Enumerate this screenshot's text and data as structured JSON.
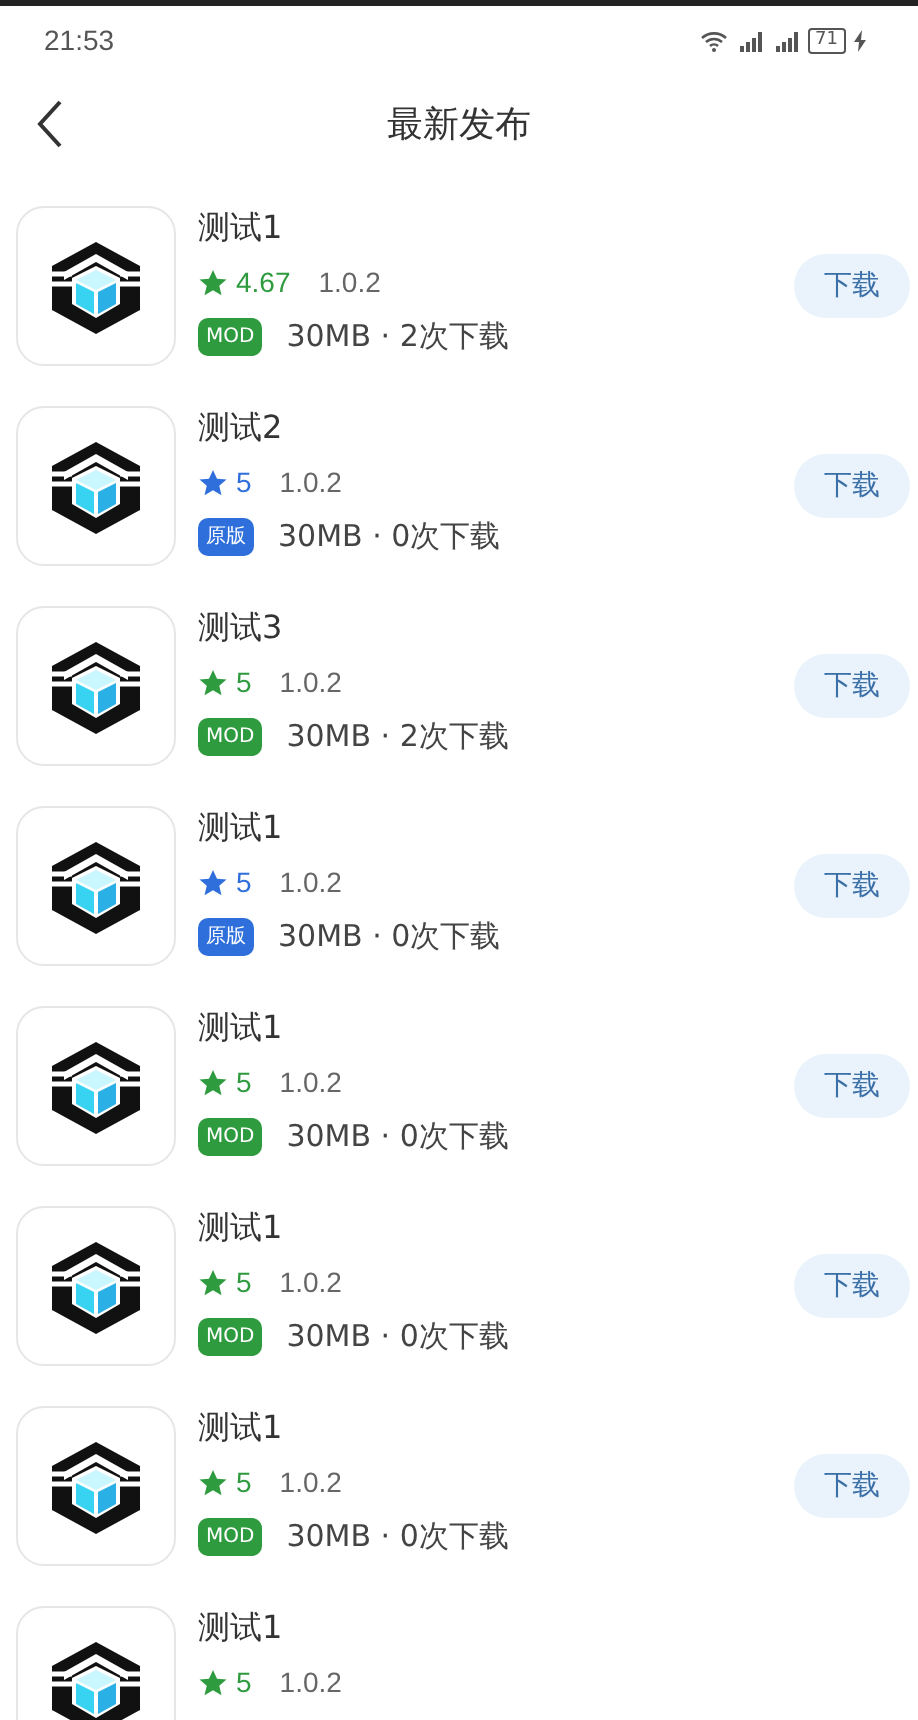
{
  "status_bar": {
    "time": "21:53",
    "battery": "71"
  },
  "header": {
    "title": "最新发布"
  },
  "apps": [
    {
      "name": "测试1",
      "kind": "mod",
      "rating": "4.67",
      "version": "1.0.2",
      "tag": "MOD",
      "meta": "30MB · 2次下载",
      "button": "下载"
    },
    {
      "name": "测试2",
      "kind": "original",
      "rating": "5",
      "version": "1.0.2",
      "tag": "原版",
      "meta": "30MB · 0次下载",
      "button": "下载"
    },
    {
      "name": "测试3",
      "kind": "mod",
      "rating": "5",
      "version": "1.0.2",
      "tag": "MOD",
      "meta": "30MB · 2次下载",
      "button": "下载"
    },
    {
      "name": "测试1",
      "kind": "original",
      "rating": "5",
      "version": "1.0.2",
      "tag": "原版",
      "meta": "30MB · 0次下载",
      "button": "下载"
    },
    {
      "name": "测试1",
      "kind": "mod",
      "rating": "5",
      "version": "1.0.2",
      "tag": "MOD",
      "meta": "30MB · 0次下载",
      "button": "下载"
    },
    {
      "name": "测试1",
      "kind": "mod",
      "rating": "5",
      "version": "1.0.2",
      "tag": "MOD",
      "meta": "30MB · 0次下载",
      "button": "下载"
    },
    {
      "name": "测试1",
      "kind": "mod",
      "rating": "5",
      "version": "1.0.2",
      "tag": "MOD",
      "meta": "30MB · 0次下载",
      "button": "下载"
    },
    {
      "name": "测试1",
      "kind": "mod",
      "rating": "5",
      "version": "1.0.2"
    }
  ]
}
